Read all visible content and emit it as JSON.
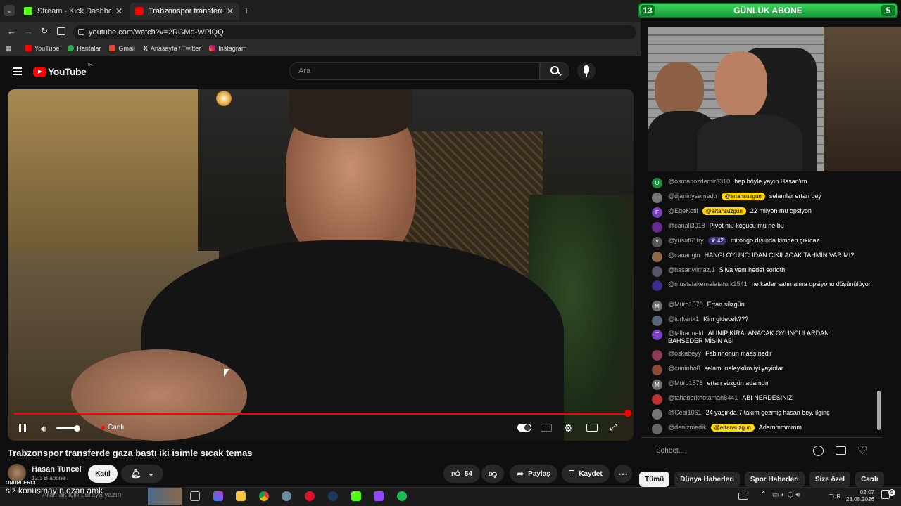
{
  "browser": {
    "tabs": [
      {
        "label": "Stream - Kick Dashboard",
        "active": false
      },
      {
        "label": "Trabzonspor transferde gaza",
        "active": true
      }
    ],
    "url": "youtube.com/watch?v=2RGMd-WPiQQ",
    "bookmarks": [
      "YouTube",
      "Haritalar",
      "Gmail",
      "Anasayfa / Twitter",
      "Instagram"
    ]
  },
  "youtube": {
    "logo": "YouTube",
    "region": "TR",
    "search_placeholder": "Ara",
    "live_label": "Canlı",
    "video_title": "Trabzonspor transferde gaza bastı iki isimle sıcak temas",
    "channel_name": "Hasan Tuncel",
    "subscribers": "12,3 B abone",
    "join_label": "Katıl",
    "likes": "54",
    "share_label": "Paylaş",
    "save_label": "Kaydet"
  },
  "overlay": {
    "title": "GÜNLÜK ABONE",
    "current": "13",
    "goal": "5"
  },
  "chat": {
    "messages": [
      {
        "user": "@osmanozdemir3310",
        "badge": "",
        "text": "hep böyle yayın Hasan'ım",
        "initial": "O",
        "color": "#1e8c3a"
      },
      {
        "user": "@djaninysemedo",
        "badge": "@ertansuzgun",
        "text": "selamlar ertan bey",
        "initial": "",
        "color": "#777"
      },
      {
        "user": "@EgeKotil",
        "badge": "@ertansuzgun",
        "text": "22 milyon mu opsiyon",
        "initial": "E",
        "color": "#7b3fc4"
      },
      {
        "user": "@canali3018",
        "badge": "",
        "text": "Pivot mu koşucu mu ne bu",
        "initial": "",
        "color": "#6a2c8c"
      },
      {
        "user": "@yusuf61try",
        "badge": "#2",
        "text": "mitongo dışında kimden çıkıcaz",
        "initial": "Y",
        "color": "#555"
      },
      {
        "user": "@canangin",
        "badge": "",
        "text": "HANGİ OYUNCUDAN ÇIKILACAK TAHMİN VAR MI?",
        "initial": "",
        "color": "#8a6a4a"
      },
      {
        "user": "@hasanyilmaz.1",
        "badge": "",
        "text": "Silva yem hedef sorloth",
        "initial": "",
        "color": "#556"
      },
      {
        "user": "@mustafakemalataturk2541",
        "badge": "",
        "text": "ne kadar satın alma opsiyonu düşünülüyor",
        "initial": "",
        "color": "#3a2b8c"
      },
      {
        "user": "@Muro1578",
        "badge": "",
        "text": "Ertan süzgün",
        "initial": "M",
        "color": "#6d6d6d"
      },
      {
        "user": "@turkertk1",
        "badge": "",
        "text": "Kim gidecek???",
        "initial": "",
        "color": "#567"
      },
      {
        "user": "@talhaunald",
        "badge": "",
        "text": "ALINIP KİRALANACAK OYUNCULARDAN BAHSEDER MİSİN ABİ",
        "initial": "T",
        "color": "#7b3fc4"
      },
      {
        "user": "@oskabeyy",
        "badge": "",
        "text": "Fabinhonun maaş nedir",
        "initial": "",
        "color": "#8c3b5a"
      },
      {
        "user": "@cuninho8",
        "badge": "",
        "text": "selamunaleyküm iyi yayinlar",
        "initial": "",
        "color": "#8c4a3a"
      },
      {
        "user": "@Muro1578",
        "badge": "",
        "text": "ertan süzgün adamdır",
        "initial": "M",
        "color": "#6d6d6d"
      },
      {
        "user": "@tahaberkhotaman8441",
        "badge": "",
        "text": "ABI NERDESINIZ",
        "initial": "",
        "color": "#b33"
      },
      {
        "user": "@Cebi1061",
        "badge": "",
        "text": "24 yaşında 7 takım gezmiş hasan bey. ilginç",
        "initial": "",
        "color": "#777"
      },
      {
        "user": "@denizmedik",
        "badge": "@ertansuzgun",
        "text": "Adammmmmm",
        "initial": "",
        "color": "#666"
      }
    ],
    "input_placeholder": "Sohbet..."
  },
  "chips": [
    "Tümü",
    "Dünya Haberleri",
    "Spor Haberleri",
    "Size özel",
    "Canlı"
  ],
  "taskbar": {
    "overlay_user": "ONURDERCI",
    "overlay_text": "siz konuşmayın ozan amk",
    "search_placeholder": "Aramak için buraya yazın",
    "lang": "TUR",
    "time": "02:07",
    "date": "23.08.2026",
    "notifications": "5"
  }
}
